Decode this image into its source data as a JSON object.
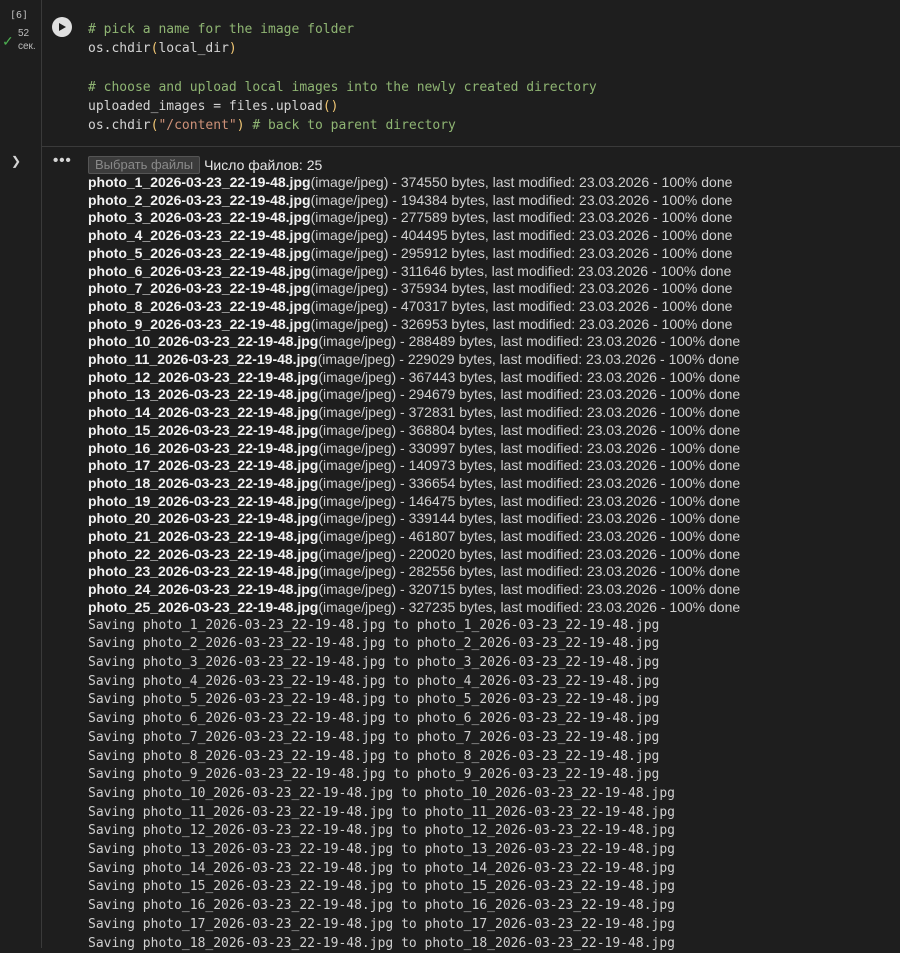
{
  "cell": {
    "execution_count": "[6]",
    "exec_time": "52\nсек.",
    "code_lines": [
      [
        {
          "t": "# pick a name for the image folder",
          "c": "comment"
        }
      ],
      [
        {
          "t": "os.chdir"
        },
        {
          "t": "(",
          "c": "paren"
        },
        {
          "t": "local_dir"
        },
        {
          "t": ")",
          "c": "paren"
        }
      ],
      [
        {
          "t": ""
        }
      ],
      [
        {
          "t": "# choose and upload local images into the newly created directory",
          "c": "comment"
        }
      ],
      [
        {
          "t": "uploaded_images = files.upload"
        },
        {
          "t": "()",
          "c": "paren"
        }
      ],
      [
        {
          "t": "os.chdir"
        },
        {
          "t": "(",
          "c": "paren"
        },
        {
          "t": "\"/content\"",
          "c": "str"
        },
        {
          "t": ")",
          "c": "paren"
        },
        {
          "t": " "
        },
        {
          "t": "# back to parent directory",
          "c": "comment"
        }
      ]
    ]
  },
  "output": {
    "file_button_label": "Выбрать файлы",
    "file_count_label": "Число файлов: 25",
    "files": [
      {
        "name": "photo_1_2026-03-23_22-19-48.jpg",
        "type": "(image/jpeg)",
        "bytes": "374550"
      },
      {
        "name": "photo_2_2026-03-23_22-19-48.jpg",
        "type": "(image/jpeg)",
        "bytes": "194384"
      },
      {
        "name": "photo_3_2026-03-23_22-19-48.jpg",
        "type": "(image/jpeg)",
        "bytes": "277589"
      },
      {
        "name": "photo_4_2026-03-23_22-19-48.jpg",
        "type": "(image/jpeg)",
        "bytes": "404495"
      },
      {
        "name": "photo_5_2026-03-23_22-19-48.jpg",
        "type": "(image/jpeg)",
        "bytes": "295912"
      },
      {
        "name": "photo_6_2026-03-23_22-19-48.jpg",
        "type": "(image/jpeg)",
        "bytes": "311646"
      },
      {
        "name": "photo_7_2026-03-23_22-19-48.jpg",
        "type": "(image/jpeg)",
        "bytes": "375934"
      },
      {
        "name": "photo_8_2026-03-23_22-19-48.jpg",
        "type": "(image/jpeg)",
        "bytes": "470317"
      },
      {
        "name": "photo_9_2026-03-23_22-19-48.jpg",
        "type": "(image/jpeg)",
        "bytes": "326953"
      },
      {
        "name": "photo_10_2026-03-23_22-19-48.jpg",
        "type": "(image/jpeg)",
        "bytes": "288489"
      },
      {
        "name": "photo_11_2026-03-23_22-19-48.jpg",
        "type": "(image/jpeg)",
        "bytes": "229029"
      },
      {
        "name": "photo_12_2026-03-23_22-19-48.jpg",
        "type": "(image/jpeg)",
        "bytes": "367443"
      },
      {
        "name": "photo_13_2026-03-23_22-19-48.jpg",
        "type": "(image/jpeg)",
        "bytes": "294679"
      },
      {
        "name": "photo_14_2026-03-23_22-19-48.jpg",
        "type": "(image/jpeg)",
        "bytes": "372831"
      },
      {
        "name": "photo_15_2026-03-23_22-19-48.jpg",
        "type": "(image/jpeg)",
        "bytes": "368804"
      },
      {
        "name": "photo_16_2026-03-23_22-19-48.jpg",
        "type": "(image/jpeg)",
        "bytes": "330997"
      },
      {
        "name": "photo_17_2026-03-23_22-19-48.jpg",
        "type": "(image/jpeg)",
        "bytes": "140973"
      },
      {
        "name": "photo_18_2026-03-23_22-19-48.jpg",
        "type": "(image/jpeg)",
        "bytes": "336654"
      },
      {
        "name": "photo_19_2026-03-23_22-19-48.jpg",
        "type": "(image/jpeg)",
        "bytes": "146475"
      },
      {
        "name": "photo_20_2026-03-23_22-19-48.jpg",
        "type": "(image/jpeg)",
        "bytes": "339144"
      },
      {
        "name": "photo_21_2026-03-23_22-19-48.jpg",
        "type": "(image/jpeg)",
        "bytes": "461807"
      },
      {
        "name": "photo_22_2026-03-23_22-19-48.jpg",
        "type": "(image/jpeg)",
        "bytes": "220020"
      },
      {
        "name": "photo_23_2026-03-23_22-19-48.jpg",
        "type": "(image/jpeg)",
        "bytes": "282556"
      },
      {
        "name": "photo_24_2026-03-23_22-19-48.jpg",
        "type": "(image/jpeg)",
        "bytes": "320715"
      },
      {
        "name": "photo_25_2026-03-23_22-19-48.jpg",
        "type": "(image/jpeg)",
        "bytes": "327235"
      }
    ],
    "bytes_suffix": " bytes, last modified: ",
    "modified_date": "23.03.2026",
    "progress_text": " - 100% done",
    "saving_lines": [
      "Saving photo_1_2026-03-23_22-19-48.jpg to photo_1_2026-03-23_22-19-48.jpg",
      "Saving photo_2_2026-03-23_22-19-48.jpg to photo_2_2026-03-23_22-19-48.jpg",
      "Saving photo_3_2026-03-23_22-19-48.jpg to photo_3_2026-03-23_22-19-48.jpg",
      "Saving photo_4_2026-03-23_22-19-48.jpg to photo_4_2026-03-23_22-19-48.jpg",
      "Saving photo_5_2026-03-23_22-19-48.jpg to photo_5_2026-03-23_22-19-48.jpg",
      "Saving photo_6_2026-03-23_22-19-48.jpg to photo_6_2026-03-23_22-19-48.jpg",
      "Saving photo_7_2026-03-23_22-19-48.jpg to photo_7_2026-03-23_22-19-48.jpg",
      "Saving photo_8_2026-03-23_22-19-48.jpg to photo_8_2026-03-23_22-19-48.jpg",
      "Saving photo_9_2026-03-23_22-19-48.jpg to photo_9_2026-03-23_22-19-48.jpg",
      "Saving photo_10_2026-03-23_22-19-48.jpg to photo_10_2026-03-23_22-19-48.jpg",
      "Saving photo_11_2026-03-23_22-19-48.jpg to photo_11_2026-03-23_22-19-48.jpg",
      "Saving photo_12_2026-03-23_22-19-48.jpg to photo_12_2026-03-23_22-19-48.jpg",
      "Saving photo_13_2026-03-23_22-19-48.jpg to photo_13_2026-03-23_22-19-48.jpg",
      "Saving photo_14_2026-03-23_22-19-48.jpg to photo_14_2026-03-23_22-19-48.jpg",
      "Saving photo_15_2026-03-23_22-19-48.jpg to photo_15_2026-03-23_22-19-48.jpg",
      "Saving photo_16_2026-03-23_22-19-48.jpg to photo_16_2026-03-23_22-19-48.jpg",
      "Saving photo_17_2026-03-23_22-19-48.jpg to photo_17_2026-03-23_22-19-48.jpg",
      "Saving photo_18_2026-03-23_22-19-48.jpg to photo_18_2026-03-23_22-19-48.jpg"
    ]
  },
  "icons": {
    "run": "play-icon",
    "status": "checkmark-icon",
    "collapse": "chevron-down-icon",
    "menu": "more-horiz-icon"
  },
  "colors": {
    "background": "#1e1e1e",
    "comment": "#8fb573",
    "string": "#ce9178",
    "paren": "#f0c674",
    "success": "#4caf50"
  }
}
